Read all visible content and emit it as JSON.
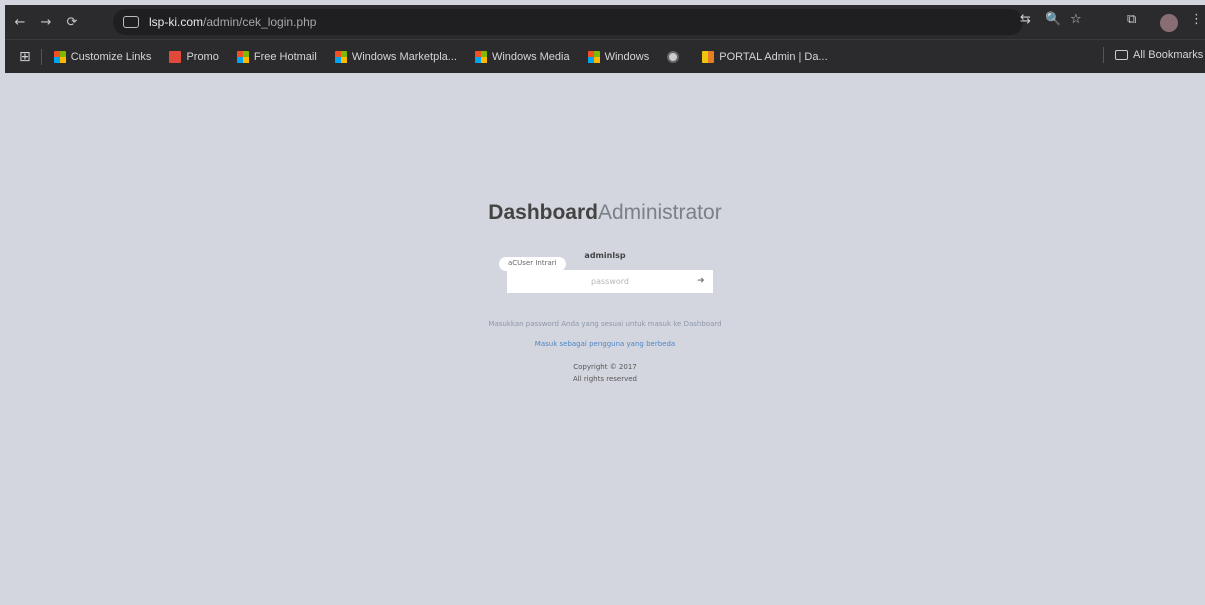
{
  "browser": {
    "url_domain": "lsp-ki.com",
    "url_path": "/admin/cek_login.php",
    "nav": {
      "back": "←",
      "forward": "→",
      "reload": "⟳"
    },
    "right_icons": {
      "translate": "⇆",
      "zoom": "🔍",
      "star": "☆",
      "extensions": "⧉",
      "menu": "⋮"
    }
  },
  "bookmarks": {
    "items": [
      {
        "label": "Customize Links",
        "icon": "ms"
      },
      {
        "label": "Promo",
        "icon": "red"
      },
      {
        "label": "Free Hotmail",
        "icon": "ms"
      },
      {
        "label": "Windows Marketpla...",
        "icon": "ms"
      },
      {
        "label": "Windows Media",
        "icon": "ms"
      },
      {
        "label": "Windows",
        "icon": "ms"
      },
      {
        "label": "",
        "icon": "globe"
      },
      {
        "label": "PORTAL Admin | Da...",
        "icon": "portal"
      }
    ],
    "all_bookmarks": "All Bookmarks"
  },
  "login": {
    "title_bold": "Dashboard",
    "title_light": "Administrator",
    "username": "adminlsp",
    "password_placeholder": "password",
    "tooltip": "aCUser Intrari",
    "instruction": "Masukkan password Anda yang sesuai untuk masuk ke Dashboard",
    "switch_link": "Masuk sebagai pengguna yang berbeda",
    "copyright_line1": "Copyright © 2017",
    "copyright_line2": "All rights reserved"
  },
  "colors": {
    "page_bg": "#d3d6de",
    "browser_bar": "#2b2b2d",
    "link": "#4f86c6"
  }
}
